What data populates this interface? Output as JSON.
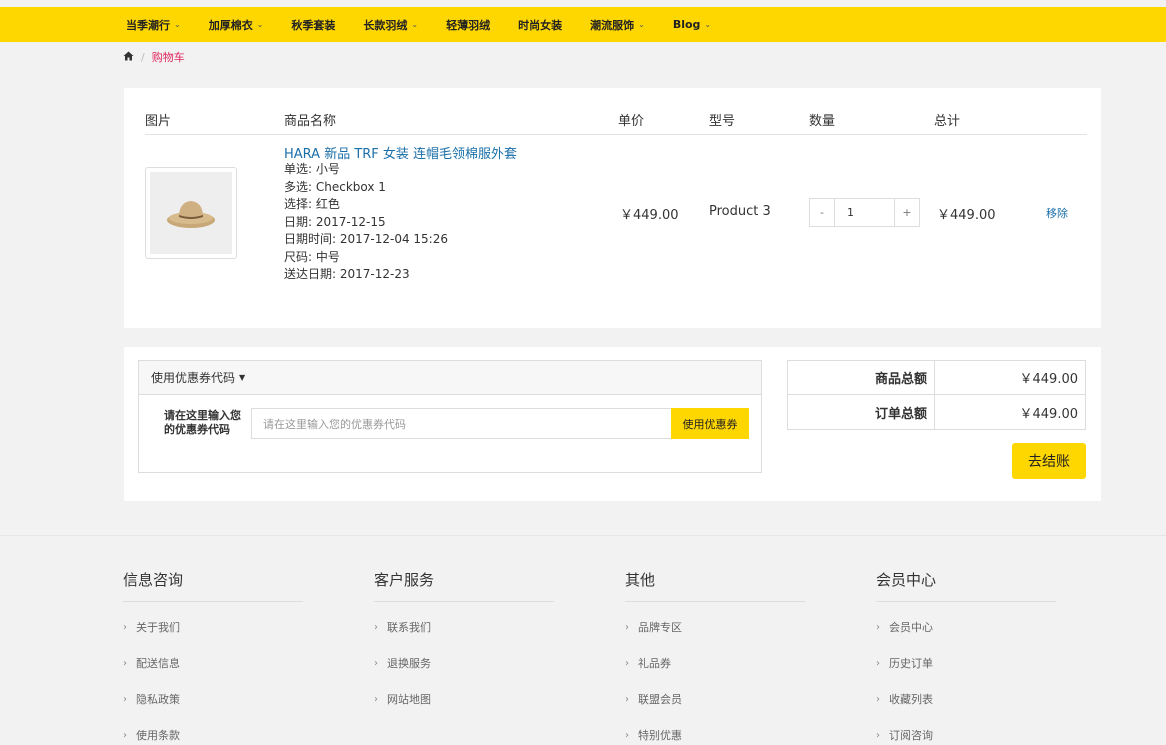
{
  "nav": {
    "items": [
      {
        "label": "当季潮行",
        "dropdown": true
      },
      {
        "label": "加厚棉衣",
        "dropdown": true
      },
      {
        "label": "秋季套装",
        "dropdown": false
      },
      {
        "label": "长款羽绒",
        "dropdown": true
      },
      {
        "label": "轻薄羽绒",
        "dropdown": false
      },
      {
        "label": "时尚女装",
        "dropdown": false
      },
      {
        "label": "潮流服饰",
        "dropdown": true
      },
      {
        "label": "Blog",
        "dropdown": true
      }
    ]
  },
  "breadcrumb": {
    "current": "购物车"
  },
  "cart": {
    "headers": {
      "image": "图片",
      "name": "商品名称",
      "unit_price": "单价",
      "model": "型号",
      "quantity": "数量",
      "total": "总计"
    },
    "item": {
      "name": "HARA 新品 TRF 女装 连帽毛领棉服外套",
      "options": [
        "单选: 小号",
        "多选: Checkbox 1",
        "选择: 红色",
        "日期: 2017-12-15",
        "日期时间: 2017-12-04 15:26",
        "尺码: 中号",
        "送达日期: 2017-12-23"
      ],
      "unit_price": "￥449.00",
      "model": "Product 3",
      "quantity": "1",
      "minus": "-",
      "plus": "+",
      "total": "￥449.00",
      "remove": "移除"
    }
  },
  "coupon": {
    "header": "使用优惠券代码",
    "label": "请在这里输入您的优惠券代码",
    "placeholder": "请在这里输入您的优惠券代码",
    "button": "使用优惠券"
  },
  "totals": {
    "subtotal_label": "商品总额",
    "subtotal_value": "￥449.00",
    "total_label": "订单总额",
    "total_value": "￥449.00",
    "checkout": "去结账"
  },
  "footer": {
    "columns": [
      {
        "title": "信息咨询",
        "links": [
          "关于我们",
          "配送信息",
          "隐私政策",
          "使用条款"
        ]
      },
      {
        "title": "客户服务",
        "links": [
          "联系我们",
          "退换服务",
          "网站地图"
        ]
      },
      {
        "title": "其他",
        "links": [
          "品牌专区",
          "礼品券",
          "联盟会员",
          "特别优惠"
        ]
      },
      {
        "title": "会员中心",
        "links": [
          "会员中心",
          "历史订单",
          "收藏列表",
          "订阅咨询"
        ]
      }
    ]
  },
  "colors": {
    "accent": "#ffd700",
    "link": "#1a6fa8",
    "breadcrumb_active": "#e0245e"
  }
}
